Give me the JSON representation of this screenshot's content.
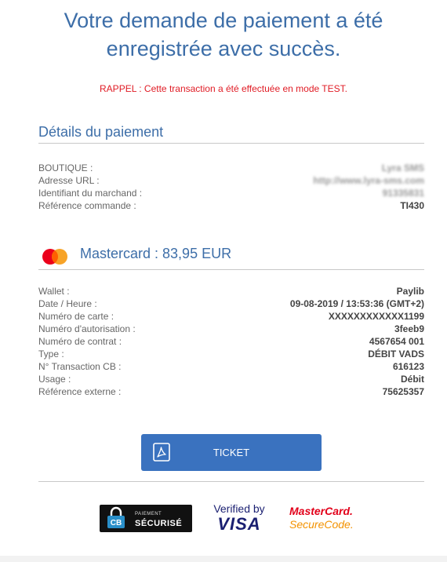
{
  "header": {
    "title_line1": "Votre demande de paiement a été",
    "title_line2": "enregistrée avec succès.",
    "reminder": "RAPPEL : Cette transaction a été effectuée en mode TEST."
  },
  "payment_details": {
    "title": "Détails du paiement",
    "rows": [
      {
        "label": "BOUTIQUE :",
        "value": "Lyra SMS"
      },
      {
        "label": "Adresse URL :",
        "value": "http://www.lyra-sms.com"
      },
      {
        "label": "Identifiant du marchand :",
        "value": "91335831"
      },
      {
        "label": "Référence commande :",
        "value": "TI430"
      }
    ]
  },
  "card_section": {
    "title": "Mastercard : 83,95 EUR",
    "logo_icon": "mastercard-logo-icon",
    "colors": {
      "red": "#eb001b",
      "orange": "#f79e1b"
    },
    "rows": [
      {
        "label": "Wallet :",
        "value": "Paylib"
      },
      {
        "label": "Date / Heure :",
        "value": "09-08-2019 / 13:53:36 (GMT+2)"
      },
      {
        "label": "Numéro de carte :",
        "value": "XXXXXXXXXXXX1199"
      },
      {
        "label": "Numéro d'autorisation :",
        "value": "3feeb9"
      },
      {
        "label": "Numéro de contrat :",
        "value": "4567654 001"
      },
      {
        "label": "Type :",
        "value": "DÉBIT VADS"
      },
      {
        "label": "N° Transaction CB :",
        "value": "616123"
      },
      {
        "label": "Usage :",
        "value": "Débit"
      },
      {
        "label": "Référence externe :",
        "value": "75625357"
      }
    ]
  },
  "ticket_button": {
    "label": "TICKET",
    "icon": "pdf-icon",
    "color": "#3a72bf"
  },
  "badges": {
    "cb_small": "PAIEMENT",
    "cb_big": "SÉCURISÉ",
    "visa_line1": "Verified by",
    "visa_line2": "VISA",
    "mc_line1": "MasterCard.",
    "mc_line2": "SecureCode."
  }
}
